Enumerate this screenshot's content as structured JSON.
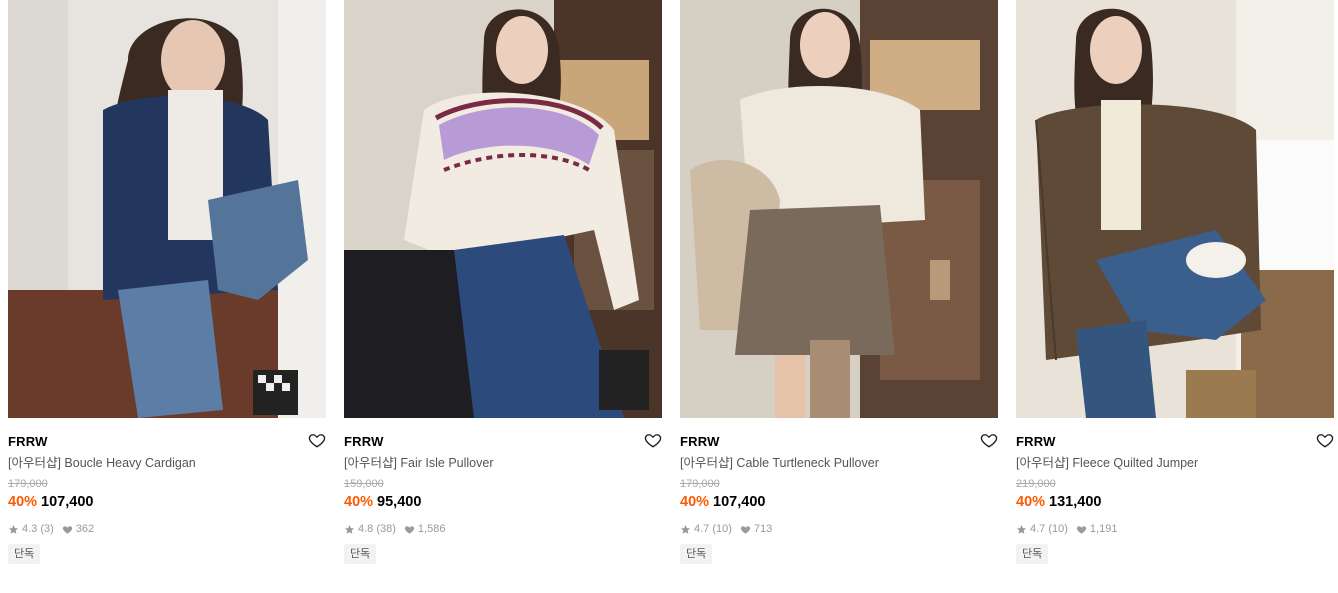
{
  "products": [
    {
      "brand": "FRRW",
      "name": "[아우터샵] Boucle Heavy Cardigan",
      "original_price": "179,000",
      "discount": "40%",
      "sale_price": "107,400",
      "rating": "4.3",
      "rating_count": "(3)",
      "likes": "362",
      "badge": "단독",
      "icon": "heart-outline-icon"
    },
    {
      "brand": "FRRW",
      "name": "[아우터샵] Fair Isle Pullover",
      "original_price": "159,000",
      "discount": "40%",
      "sale_price": "95,400",
      "rating": "4.8",
      "rating_count": "(38)",
      "likes": "1,586",
      "badge": "단독",
      "icon": "heart-outline-icon"
    },
    {
      "brand": "FRRW",
      "name": "[아우터샵] Cable Turtleneck Pullover",
      "original_price": "179,000",
      "discount": "40%",
      "sale_price": "107,400",
      "rating": "4.7",
      "rating_count": "(10)",
      "likes": "713",
      "badge": "단독",
      "icon": "heart-outline-icon"
    },
    {
      "brand": "FRRW",
      "name": "[아우터샵] Fleece Quilted Jumper",
      "original_price": "219,000",
      "discount": "40%",
      "sale_price": "131,400",
      "rating": "4.7",
      "rating_count": "(10)",
      "likes": "1,191",
      "badge": "단독",
      "icon": "heart-outline-icon"
    }
  ],
  "colors": {
    "discount": "#ff5a00",
    "meta_gray": "#9a9a9a"
  }
}
